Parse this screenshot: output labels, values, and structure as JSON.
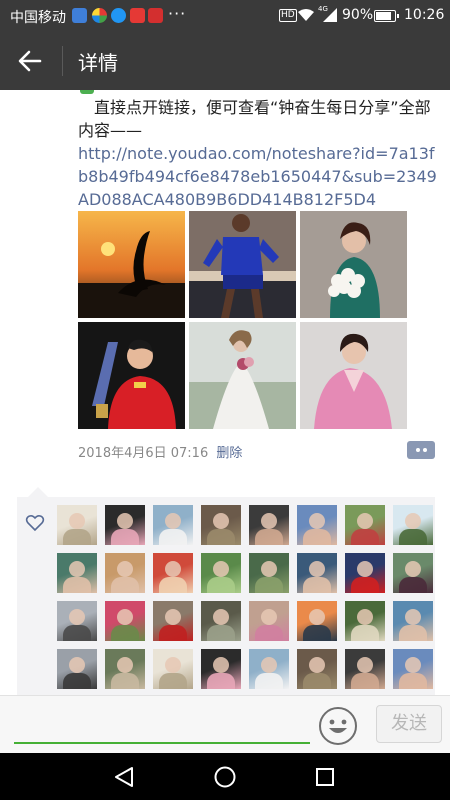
{
  "status_bar": {
    "carrier": "中国移动",
    "more": "···",
    "hd": "HD",
    "network": "4G",
    "battery": "90%",
    "battery_level": 0.9,
    "time": "10:26"
  },
  "header": {
    "title": "详情"
  },
  "post": {
    "text": "直接点开链接，便可查看“钟奋生每日分享”全部内容——",
    "link": "http://note.youdao.com/noteshare?id=7a13fb8b49fb494cf6e8478eb1650447&sub=2349AD088ACA480B9B6DD414B812F5D4",
    "images": [
      "sunset-crane-photo",
      "soccer-player-photo",
      "woman-with-roses-photo",
      "table-tennis-trophy-photo",
      "bride-in-field-photo",
      "woman-pink-suit-photo"
    ],
    "date": "2018年4月6日 07:16",
    "delete_label": "删除"
  },
  "likes": {
    "count": 34,
    "heart_icon": "heart-outline-icon"
  },
  "input": {
    "placeholder": "",
    "send_label": "发送"
  },
  "colors": {
    "bar": "#3a3a3a",
    "link": "#576b95",
    "accent_green": "#45b035",
    "likes_bg": "#f3f3f5"
  }
}
